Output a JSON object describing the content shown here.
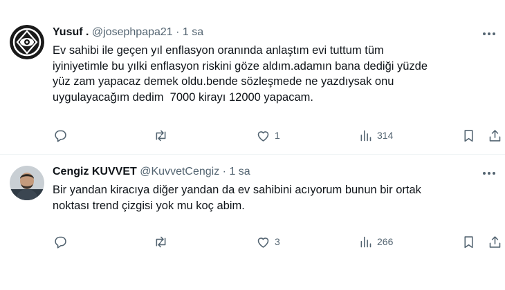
{
  "tweets": [
    {
      "author_name": "Yusuf .",
      "author_handle": "@josephpapa21",
      "separator": "·",
      "time": "1 sa",
      "text_lines": [
        "Ev sahibi ile geçen yıl enflasyon oranında anlaştım evi tuttum tüm",
        "iyiniyetimle bu yılki enflasyon riskini göze aldım.adamın bana dediği yüzde",
        "yüz zam yapacaz demek oldu.bende sözleşmede ne yazdıysak onu",
        "uygulayacağım dedim  7000 kirayı 12000 yapacam."
      ],
      "reply_count": "",
      "retweet_count": "",
      "like_count": "1",
      "view_count": "314"
    },
    {
      "author_name": "Cengiz KUVVET",
      "author_handle": "@KuvvetCengiz",
      "separator": "·",
      "time": "1 sa",
      "text_lines": [
        "Bir yandan kiracıya diğer yandan da ev sahibini acıyorum bunun bir ortak",
        "noktası trend çizgisi yok mu koç abim."
      ],
      "reply_count": "",
      "retweet_count": "",
      "like_count": "3",
      "view_count": "266"
    }
  ],
  "icons": {
    "more": "more-horizontal-icon",
    "reply": "reply-icon",
    "retweet": "retweet-icon",
    "like": "heart-icon",
    "views": "views-chart-icon",
    "bookmark": "bookmark-icon",
    "share": "share-icon"
  },
  "colors": {
    "text": "#0f1419",
    "secondary": "#536471",
    "divider": "#eff3f4"
  }
}
